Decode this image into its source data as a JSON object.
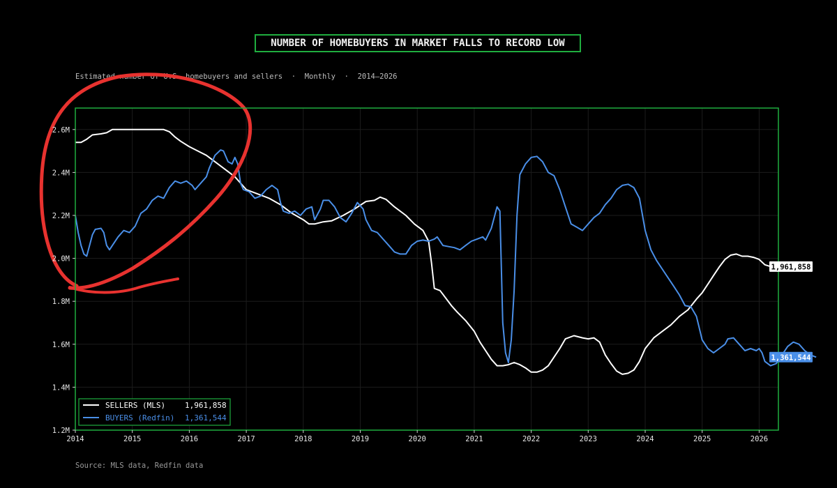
{
  "title": "NUMBER OF HOMEBUYERS IN MARKET FALLS TO RECORD LOW",
  "subtitle": "Estimated number of U.S. homebuyers and sellers  ·  Monthly  ·  2014–2026",
  "source": "Source: MLS data, Redfin data",
  "colors": {
    "sellers": "#ffffff",
    "buyers": "#4a8fe8",
    "frame": "#1fae3f",
    "annotation": "#e8322f",
    "background": "#000000"
  },
  "chart_data": {
    "type": "line",
    "title": "NUMBER OF HOMEBUYERS IN MARKET FALLS TO RECORD LOW",
    "xlabel": "",
    "ylabel": "",
    "xlim": [
      2014.0,
      2026.35
    ],
    "ylim": [
      1200000,
      2700000
    ],
    "x_ticks": [
      2014,
      2015,
      2016,
      2017,
      2018,
      2019,
      2020,
      2021,
      2022,
      2023,
      2024,
      2025,
      2026
    ],
    "x_tick_labels": [
      "2014",
      "2015",
      "2016",
      "2017",
      "2018",
      "2019",
      "2020",
      "2021",
      "2022",
      "2023",
      "2024",
      "2025",
      "2026"
    ],
    "y_ticks": [
      1200000,
      1400000,
      1600000,
      1800000,
      2000000,
      2200000,
      2400000,
      2600000
    ],
    "y_tick_labels": [
      "1.2M",
      "1.4M",
      "1.6M",
      "1.8M",
      "2.0M",
      "2.2M",
      "2.4M",
      "2.6M"
    ],
    "grid": true,
    "legend_position": "bottom-left",
    "series": [
      {
        "name": "SELLERS (MLS)",
        "latest": "1,961,858",
        "color": "#ffffff",
        "points": [
          [
            2014.0,
            2540000
          ],
          [
            2014.1,
            2540000
          ],
          [
            2014.2,
            2555000
          ],
          [
            2014.3,
            2575000
          ],
          [
            2014.45,
            2580000
          ],
          [
            2014.55,
            2585000
          ],
          [
            2014.65,
            2600000
          ],
          [
            2014.8,
            2600000
          ],
          [
            2015.0,
            2600000
          ],
          [
            2015.3,
            2600000
          ],
          [
            2015.55,
            2600000
          ],
          [
            2015.65,
            2590000
          ],
          [
            2015.75,
            2565000
          ],
          [
            2015.85,
            2545000
          ],
          [
            2016.0,
            2520000
          ],
          [
            2016.15,
            2500000
          ],
          [
            2016.3,
            2480000
          ],
          [
            2016.4,
            2460000
          ],
          [
            2016.6,
            2420000
          ],
          [
            2016.8,
            2380000
          ],
          [
            2017.0,
            2320000
          ],
          [
            2017.2,
            2300000
          ],
          [
            2017.4,
            2280000
          ],
          [
            2017.6,
            2250000
          ],
          [
            2017.8,
            2210000
          ],
          [
            2018.0,
            2180000
          ],
          [
            2018.1,
            2160000
          ],
          [
            2018.2,
            2160000
          ],
          [
            2018.35,
            2170000
          ],
          [
            2018.5,
            2175000
          ],
          [
            2018.7,
            2200000
          ],
          [
            2018.9,
            2230000
          ],
          [
            2019.1,
            2265000
          ],
          [
            2019.25,
            2270000
          ],
          [
            2019.35,
            2285000
          ],
          [
            2019.45,
            2275000
          ],
          [
            2019.6,
            2240000
          ],
          [
            2019.8,
            2200000
          ],
          [
            2019.95,
            2160000
          ],
          [
            2020.1,
            2130000
          ],
          [
            2020.2,
            2080000
          ],
          [
            2020.25,
            1980000
          ],
          [
            2020.3,
            1860000
          ],
          [
            2020.4,
            1850000
          ],
          [
            2020.5,
            1815000
          ],
          [
            2020.6,
            1780000
          ],
          [
            2020.7,
            1750000
          ],
          [
            2020.85,
            1710000
          ],
          [
            2021.0,
            1660000
          ],
          [
            2021.1,
            1610000
          ],
          [
            2021.2,
            1570000
          ],
          [
            2021.3,
            1530000
          ],
          [
            2021.4,
            1500000
          ],
          [
            2021.5,
            1500000
          ],
          [
            2021.6,
            1505000
          ],
          [
            2021.7,
            1515000
          ],
          [
            2021.8,
            1505000
          ],
          [
            2021.9,
            1490000
          ],
          [
            2022.0,
            1470000
          ],
          [
            2022.1,
            1470000
          ],
          [
            2022.2,
            1480000
          ],
          [
            2022.3,
            1500000
          ],
          [
            2022.4,
            1540000
          ],
          [
            2022.5,
            1580000
          ],
          [
            2022.6,
            1625000
          ],
          [
            2022.75,
            1640000
          ],
          [
            2022.9,
            1630000
          ],
          [
            2023.0,
            1625000
          ],
          [
            2023.1,
            1630000
          ],
          [
            2023.2,
            1610000
          ],
          [
            2023.3,
            1550000
          ],
          [
            2023.4,
            1510000
          ],
          [
            2023.5,
            1475000
          ],
          [
            2023.6,
            1460000
          ],
          [
            2023.7,
            1465000
          ],
          [
            2023.8,
            1480000
          ],
          [
            2023.9,
            1520000
          ],
          [
            2024.0,
            1580000
          ],
          [
            2024.15,
            1630000
          ],
          [
            2024.3,
            1660000
          ],
          [
            2024.45,
            1690000
          ],
          [
            2024.6,
            1730000
          ],
          [
            2024.75,
            1760000
          ],
          [
            2024.9,
            1810000
          ],
          [
            2025.0,
            1840000
          ],
          [
            2025.1,
            1880000
          ],
          [
            2025.2,
            1920000
          ],
          [
            2025.3,
            1960000
          ],
          [
            2025.4,
            1995000
          ],
          [
            2025.5,
            2015000
          ],
          [
            2025.6,
            2020000
          ],
          [
            2025.7,
            2010000
          ],
          [
            2025.8,
            2010000
          ],
          [
            2025.9,
            2005000
          ],
          [
            2026.0,
            1995000
          ],
          [
            2026.1,
            1970000
          ],
          [
            2026.2,
            1961858
          ]
        ]
      },
      {
        "name": "BUYERS (Redfin)",
        "latest": "1,361,544",
        "color": "#4a8fe8",
        "points": [
          [
            2014.0,
            2200000
          ],
          [
            2014.05,
            2120000
          ],
          [
            2014.1,
            2060000
          ],
          [
            2014.15,
            2020000
          ],
          [
            2014.2,
            2010000
          ],
          [
            2014.25,
            2060000
          ],
          [
            2014.3,
            2110000
          ],
          [
            2014.35,
            2135000
          ],
          [
            2014.45,
            2140000
          ],
          [
            2014.5,
            2120000
          ],
          [
            2014.55,
            2060000
          ],
          [
            2014.6,
            2040000
          ],
          [
            2014.65,
            2060000
          ],
          [
            2014.75,
            2100000
          ],
          [
            2014.85,
            2130000
          ],
          [
            2014.95,
            2120000
          ],
          [
            2015.05,
            2150000
          ],
          [
            2015.15,
            2210000
          ],
          [
            2015.25,
            2230000
          ],
          [
            2015.35,
            2270000
          ],
          [
            2015.45,
            2290000
          ],
          [
            2015.55,
            2280000
          ],
          [
            2015.65,
            2330000
          ],
          [
            2015.75,
            2360000
          ],
          [
            2015.85,
            2350000
          ],
          [
            2015.95,
            2360000
          ],
          [
            2016.05,
            2340000
          ],
          [
            2016.1,
            2320000
          ],
          [
            2016.2,
            2350000
          ],
          [
            2016.3,
            2380000
          ],
          [
            2016.35,
            2420000
          ],
          [
            2016.45,
            2480000
          ],
          [
            2016.55,
            2505000
          ],
          [
            2016.6,
            2500000
          ],
          [
            2016.68,
            2450000
          ],
          [
            2016.75,
            2440000
          ],
          [
            2016.8,
            2470000
          ],
          [
            2016.85,
            2440000
          ],
          [
            2016.9,
            2350000
          ],
          [
            2016.95,
            2320000
          ],
          [
            2017.05,
            2310000
          ],
          [
            2017.15,
            2280000
          ],
          [
            2017.25,
            2290000
          ],
          [
            2017.35,
            2320000
          ],
          [
            2017.45,
            2340000
          ],
          [
            2017.55,
            2320000
          ],
          [
            2017.6,
            2260000
          ],
          [
            2017.65,
            2220000
          ],
          [
            2017.75,
            2210000
          ],
          [
            2017.85,
            2220000
          ],
          [
            2017.95,
            2200000
          ],
          [
            2018.05,
            2230000
          ],
          [
            2018.15,
            2240000
          ],
          [
            2018.2,
            2180000
          ],
          [
            2018.3,
            2230000
          ],
          [
            2018.35,
            2270000
          ],
          [
            2018.45,
            2270000
          ],
          [
            2018.55,
            2240000
          ],
          [
            2018.65,
            2190000
          ],
          [
            2018.75,
            2170000
          ],
          [
            2018.85,
            2210000
          ],
          [
            2018.95,
            2260000
          ],
          [
            2019.05,
            2230000
          ],
          [
            2019.1,
            2180000
          ],
          [
            2019.2,
            2130000
          ],
          [
            2019.3,
            2120000
          ],
          [
            2019.4,
            2090000
          ],
          [
            2019.5,
            2060000
          ],
          [
            2019.6,
            2030000
          ],
          [
            2019.7,
            2020000
          ],
          [
            2019.8,
            2020000
          ],
          [
            2019.9,
            2060000
          ],
          [
            2020.0,
            2080000
          ],
          [
            2020.1,
            2085000
          ],
          [
            2020.2,
            2080000
          ],
          [
            2020.3,
            2090000
          ],
          [
            2020.35,
            2100000
          ],
          [
            2020.45,
            2060000
          ],
          [
            2020.55,
            2055000
          ],
          [
            2020.65,
            2050000
          ],
          [
            2020.75,
            2040000
          ],
          [
            2020.85,
            2060000
          ],
          [
            2020.95,
            2080000
          ],
          [
            2021.05,
            2090000
          ],
          [
            2021.15,
            2100000
          ],
          [
            2021.2,
            2085000
          ],
          [
            2021.3,
            2140000
          ],
          [
            2021.35,
            2190000
          ],
          [
            2021.4,
            2240000
          ],
          [
            2021.45,
            2220000
          ],
          [
            2021.5,
            1700000
          ],
          [
            2021.55,
            1560000
          ],
          [
            2021.6,
            1515000
          ],
          [
            2021.65,
            1620000
          ],
          [
            2021.7,
            1850000
          ],
          [
            2021.75,
            2200000
          ],
          [
            2021.8,
            2390000
          ],
          [
            2021.9,
            2440000
          ],
          [
            2022.0,
            2470000
          ],
          [
            2022.1,
            2475000
          ],
          [
            2022.2,
            2450000
          ],
          [
            2022.3,
            2400000
          ],
          [
            2022.4,
            2385000
          ],
          [
            2022.5,
            2320000
          ],
          [
            2022.6,
            2240000
          ],
          [
            2022.7,
            2160000
          ],
          [
            2022.8,
            2145000
          ],
          [
            2022.9,
            2130000
          ],
          [
            2023.0,
            2160000
          ],
          [
            2023.1,
            2190000
          ],
          [
            2023.2,
            2210000
          ],
          [
            2023.3,
            2250000
          ],
          [
            2023.4,
            2280000
          ],
          [
            2023.5,
            2320000
          ],
          [
            2023.6,
            2340000
          ],
          [
            2023.7,
            2345000
          ],
          [
            2023.8,
            2330000
          ],
          [
            2023.9,
            2280000
          ],
          [
            2024.0,
            2130000
          ],
          [
            2024.1,
            2040000
          ],
          [
            2024.2,
            1990000
          ],
          [
            2024.3,
            1950000
          ],
          [
            2024.4,
            1910000
          ],
          [
            2024.5,
            1870000
          ],
          [
            2024.6,
            1830000
          ],
          [
            2024.7,
            1780000
          ],
          [
            2024.8,
            1775000
          ],
          [
            2024.9,
            1730000
          ],
          [
            2025.0,
            1620000
          ],
          [
            2025.1,
            1580000
          ],
          [
            2025.2,
            1560000
          ],
          [
            2025.3,
            1580000
          ],
          [
            2025.4,
            1600000
          ],
          [
            2025.45,
            1625000
          ],
          [
            2025.55,
            1630000
          ],
          [
            2025.65,
            1600000
          ],
          [
            2025.75,
            1570000
          ],
          [
            2025.85,
            1580000
          ],
          [
            2025.95,
            1570000
          ],
          [
            2026.0,
            1580000
          ],
          [
            2026.05,
            1560000
          ],
          [
            2026.1,
            1520000
          ],
          [
            2026.2,
            1500000
          ],
          [
            2026.3,
            1510000
          ],
          [
            2026.4,
            1550000
          ],
          [
            2026.5,
            1590000
          ],
          [
            2026.6,
            1610000
          ],
          [
            2026.7,
            1600000
          ],
          [
            2026.8,
            1570000
          ],
          [
            2026.9,
            1550000
          ],
          [
            2027.0,
            1540000
          ]
        ]
      }
    ]
  }
}
